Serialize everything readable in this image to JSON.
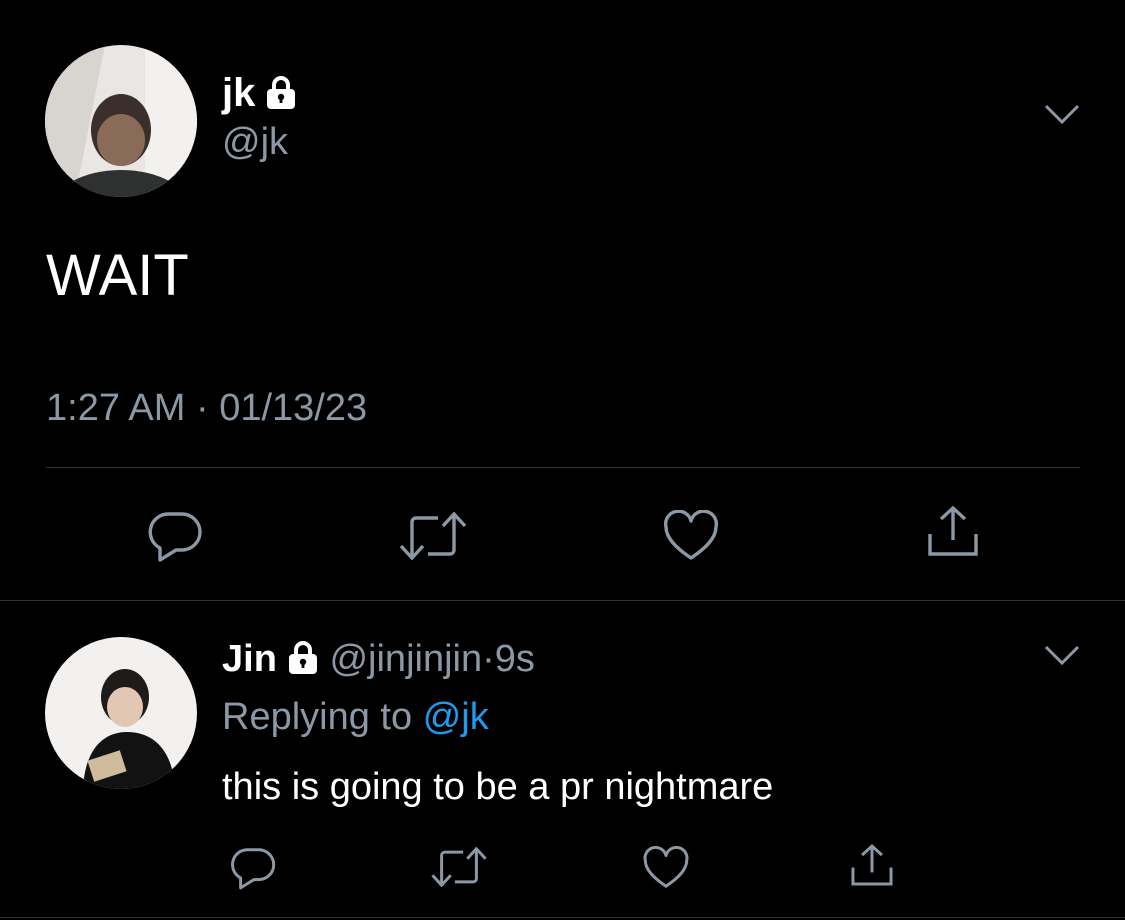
{
  "tweet": {
    "display_name": "jk",
    "username": "@jk",
    "protected": true,
    "text": "WAIT",
    "time": "1:27 AM",
    "separator": "·",
    "date": "01/13/23",
    "actions": [
      "reply-icon",
      "retweet-icon",
      "like-icon",
      "share-icon"
    ]
  },
  "reply": {
    "display_name": "Jin",
    "username": "@jinjinjin",
    "separator": "·",
    "age": "9s",
    "replying_to_label": "Replying to",
    "replying_to_handle": "@jk",
    "text": "this is going to be a pr nightmare",
    "actions": [
      "reply-icon",
      "retweet-icon",
      "like-icon",
      "share-icon"
    ]
  },
  "colors": {
    "background": "#000000",
    "text_primary": "#ffffff",
    "text_secondary": "#8b98a5",
    "link": "#1d9bf0",
    "divider": "#2f3336",
    "icon": "#8b98a5"
  }
}
